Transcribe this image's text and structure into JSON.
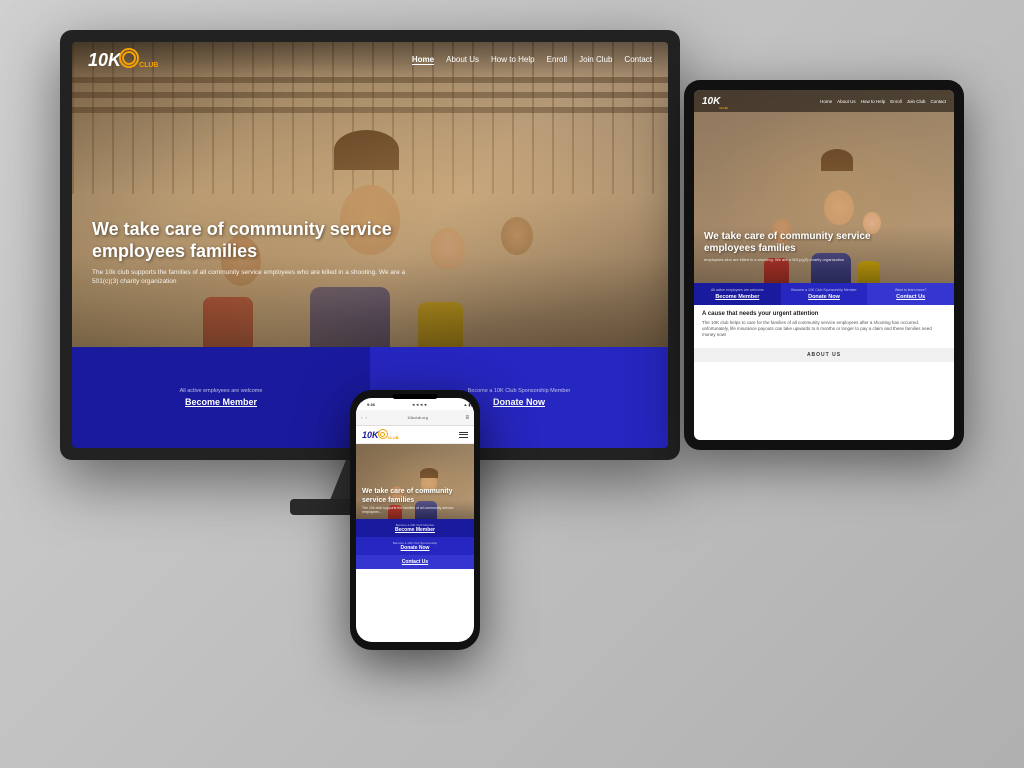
{
  "scene": {
    "background_color": "#c8c8c8"
  },
  "website": {
    "logo": {
      "text_main": "10K",
      "text_sub": "CLUB",
      "icon_label": "club-logo-icon"
    },
    "nav": {
      "links": [
        {
          "label": "Home",
          "active": true
        },
        {
          "label": "About Us",
          "active": false
        },
        {
          "label": "How to Help",
          "active": false
        },
        {
          "label": "Enroll",
          "active": false
        },
        {
          "label": "Join Club",
          "active": false
        },
        {
          "label": "Contact",
          "active": false
        }
      ]
    },
    "hero": {
      "title": "We take care of community service employees families",
      "subtitle": "The 10k club supports the families of all community service employees who are killed in a shooting. We are a 501(c)(3) charity organization"
    },
    "cta": {
      "left": {
        "small_text": "All active employees are welcome",
        "button_label": "Become Member"
      },
      "right": {
        "small_text": "Become a 10K Club Sponsorship Member",
        "button_label": "Donate Now"
      }
    },
    "below_fold": {
      "left_heading": "A cause that needs your",
      "right_text": "The 10K club helps to care for the families of a..."
    }
  },
  "tablet": {
    "nav": {
      "logo": "10K",
      "logo_sub": "CLUB",
      "links": [
        "Home",
        "About Us",
        "How to Help",
        "Enroll",
        "Join Club",
        "Contact"
      ]
    },
    "hero": {
      "title": "We take care of community service employees families",
      "subtitle": "employees who are killed in a shooting. We are a 501(c)(3) charity organization"
    },
    "cta": [
      {
        "small": "All active employees are welcome",
        "button": "Become Member"
      },
      {
        "small": "Become a 10K Club Sponsorship Member",
        "button": "Donate Now"
      },
      {
        "small": "Want to learn more?",
        "button": "Contact Us"
      }
    ],
    "content": {
      "title": "A cause that needs your urgent attention",
      "text": "The 10K club helps to care for the families of all community service employees after a shooting has occurred. unfortunately, life insurance payouts can take upwards to 6 months or longer to pay a claim and these families need money now!"
    },
    "about_label": "ABOUT US"
  },
  "phone": {
    "status_bar": {
      "time": "9:36",
      "carrier": "◄◄◄◄",
      "wifi": "WiFi",
      "battery": "■■■"
    },
    "browser_bar": {
      "url": "10kclub.org",
      "menu": "≡"
    },
    "nav": {
      "logo": "10K",
      "logo_sub": "CLUB"
    },
    "hero": {
      "title": "We take care of community service families",
      "subtitle": "The 10k club supports the families of all community service employees..."
    },
    "cta": [
      {
        "small": "Become a 10K Club Member",
        "button": "Become Member"
      },
      {
        "small": "Become a 10K Club Sponsorship",
        "button": "Donate Now"
      },
      {
        "small": "",
        "button": "Contact Us"
      }
    ]
  }
}
